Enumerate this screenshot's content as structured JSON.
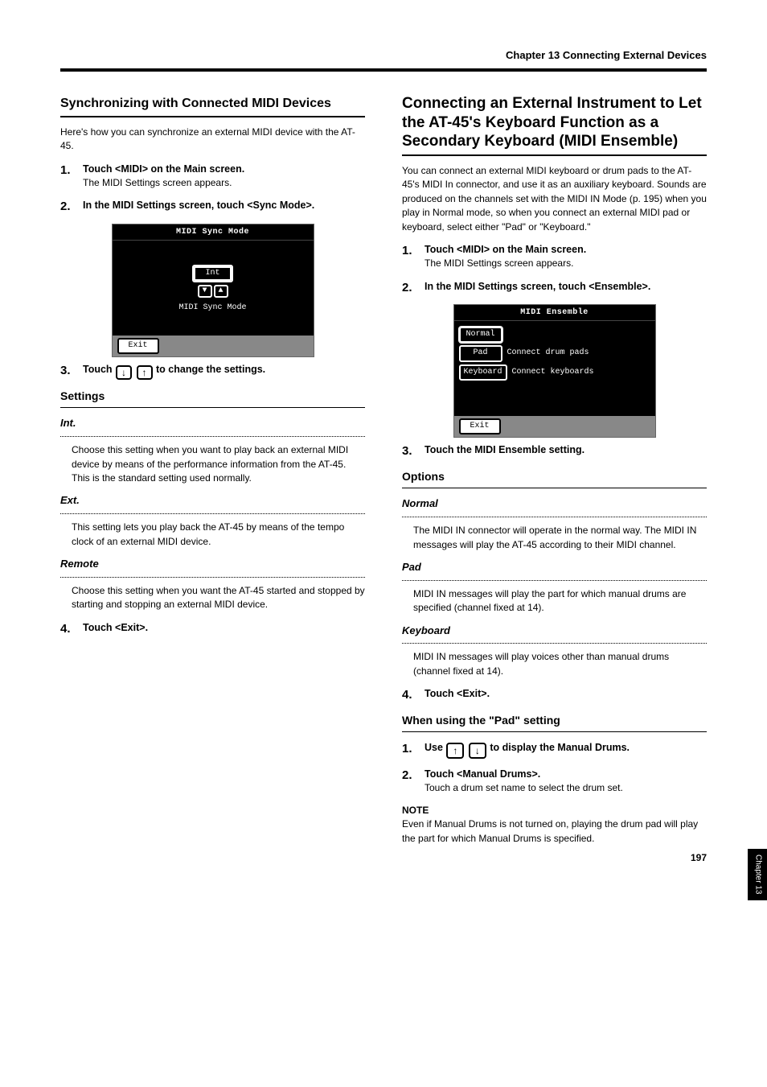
{
  "page": {
    "chapter_title": "Chapter 13 Connecting External Devices",
    "page_number": "197",
    "side_tab": "Chapter 13"
  },
  "left": {
    "section_title": "Synchronizing with Connected MIDI Devices",
    "intro": "Here's how you can synchronize an external MIDI device with the AT-45.",
    "step1_lead": "Touch <MIDI> on the Main screen.",
    "step1_body": "The MIDI Settings screen appears.",
    "step2_lead": "In the MIDI Settings screen, touch <Sync Mode>.",
    "screen": {
      "title": "MIDI Sync Mode",
      "value": "Int",
      "caption": "MIDI Sync Mode",
      "exit": "Exit"
    },
    "step3_lead": "Touch ",
    "step3_lead_tail": " to change the settings.",
    "settings_heading": "Settings",
    "int_label": "Int.",
    "int_body": "Choose this setting when you want to play back an external MIDI device by means of the performance information from the AT-45. This is the standard setting used normally.",
    "ext_label": "Ext.",
    "ext_body": "This setting lets you play back the AT-45 by means of the tempo clock of an external MIDI device.",
    "remote_label": "Remote",
    "remote_body": "Choose this setting when you want the AT-45 started and stopped by starting and stopping an external MIDI device.",
    "step4_lead": "Touch <Exit>."
  },
  "right": {
    "section_title": "Connecting an External Instrument to Let the AT-45's Keyboard Function as a Secondary Keyboard (MIDI Ensemble)",
    "intro": "You can connect an external MIDI keyboard or drum pads to the AT-45's MIDI In connector, and use it as an auxiliary keyboard. Sounds are produced on the channels set with the MIDI IN Mode (p. 195) when you play in Normal mode, so when you connect an external MIDI pad or keyboard, select either \"Pad\" or \"Keyboard.\"",
    "step1_lead": "Touch <MIDI> on the Main screen.",
    "step1_body": "The MIDI Settings screen appears.",
    "step2_lead": "In the MIDI Settings screen, touch <Ensemble>.",
    "screen": {
      "title": "MIDI Ensemble",
      "normal": "Normal",
      "pad": "Pad",
      "pad_desc": "Connect drum pads",
      "keyboard": "Keyboard",
      "keyboard_desc": "Connect keyboards",
      "exit": "Exit"
    },
    "step3_lead": "Touch the MIDI Ensemble setting.",
    "options_heading": "Options",
    "normal_label": "Normal",
    "normal_body": "The MIDI IN connector will operate in the normal way. The MIDI IN messages will play the AT-45 according to their MIDI channel.",
    "pad_label": "Pad",
    "pad_body": "MIDI IN messages will play the part for which manual drums are specified (channel fixed at 14).",
    "keyboard_label": "Keyboard",
    "keyboard_body": "MIDI IN messages will play voices other than manual drums (channel fixed at 14).",
    "step4_lead": "Touch <Exit>.",
    "sub_heading": "When using the \"Pad\" setting",
    "pad_step1": "Use ",
    "pad_step1_tail": " to display the Manual Drums.",
    "pad_step2_lead": "Touch <Manual Drums>.",
    "pad_step2_body": "Touch a drum set name to select the drum set.",
    "note_head": "NOTE",
    "note_body": "Even if Manual Drums is not turned on, playing the drum pad will play the part for which Manual Drums is specified."
  }
}
